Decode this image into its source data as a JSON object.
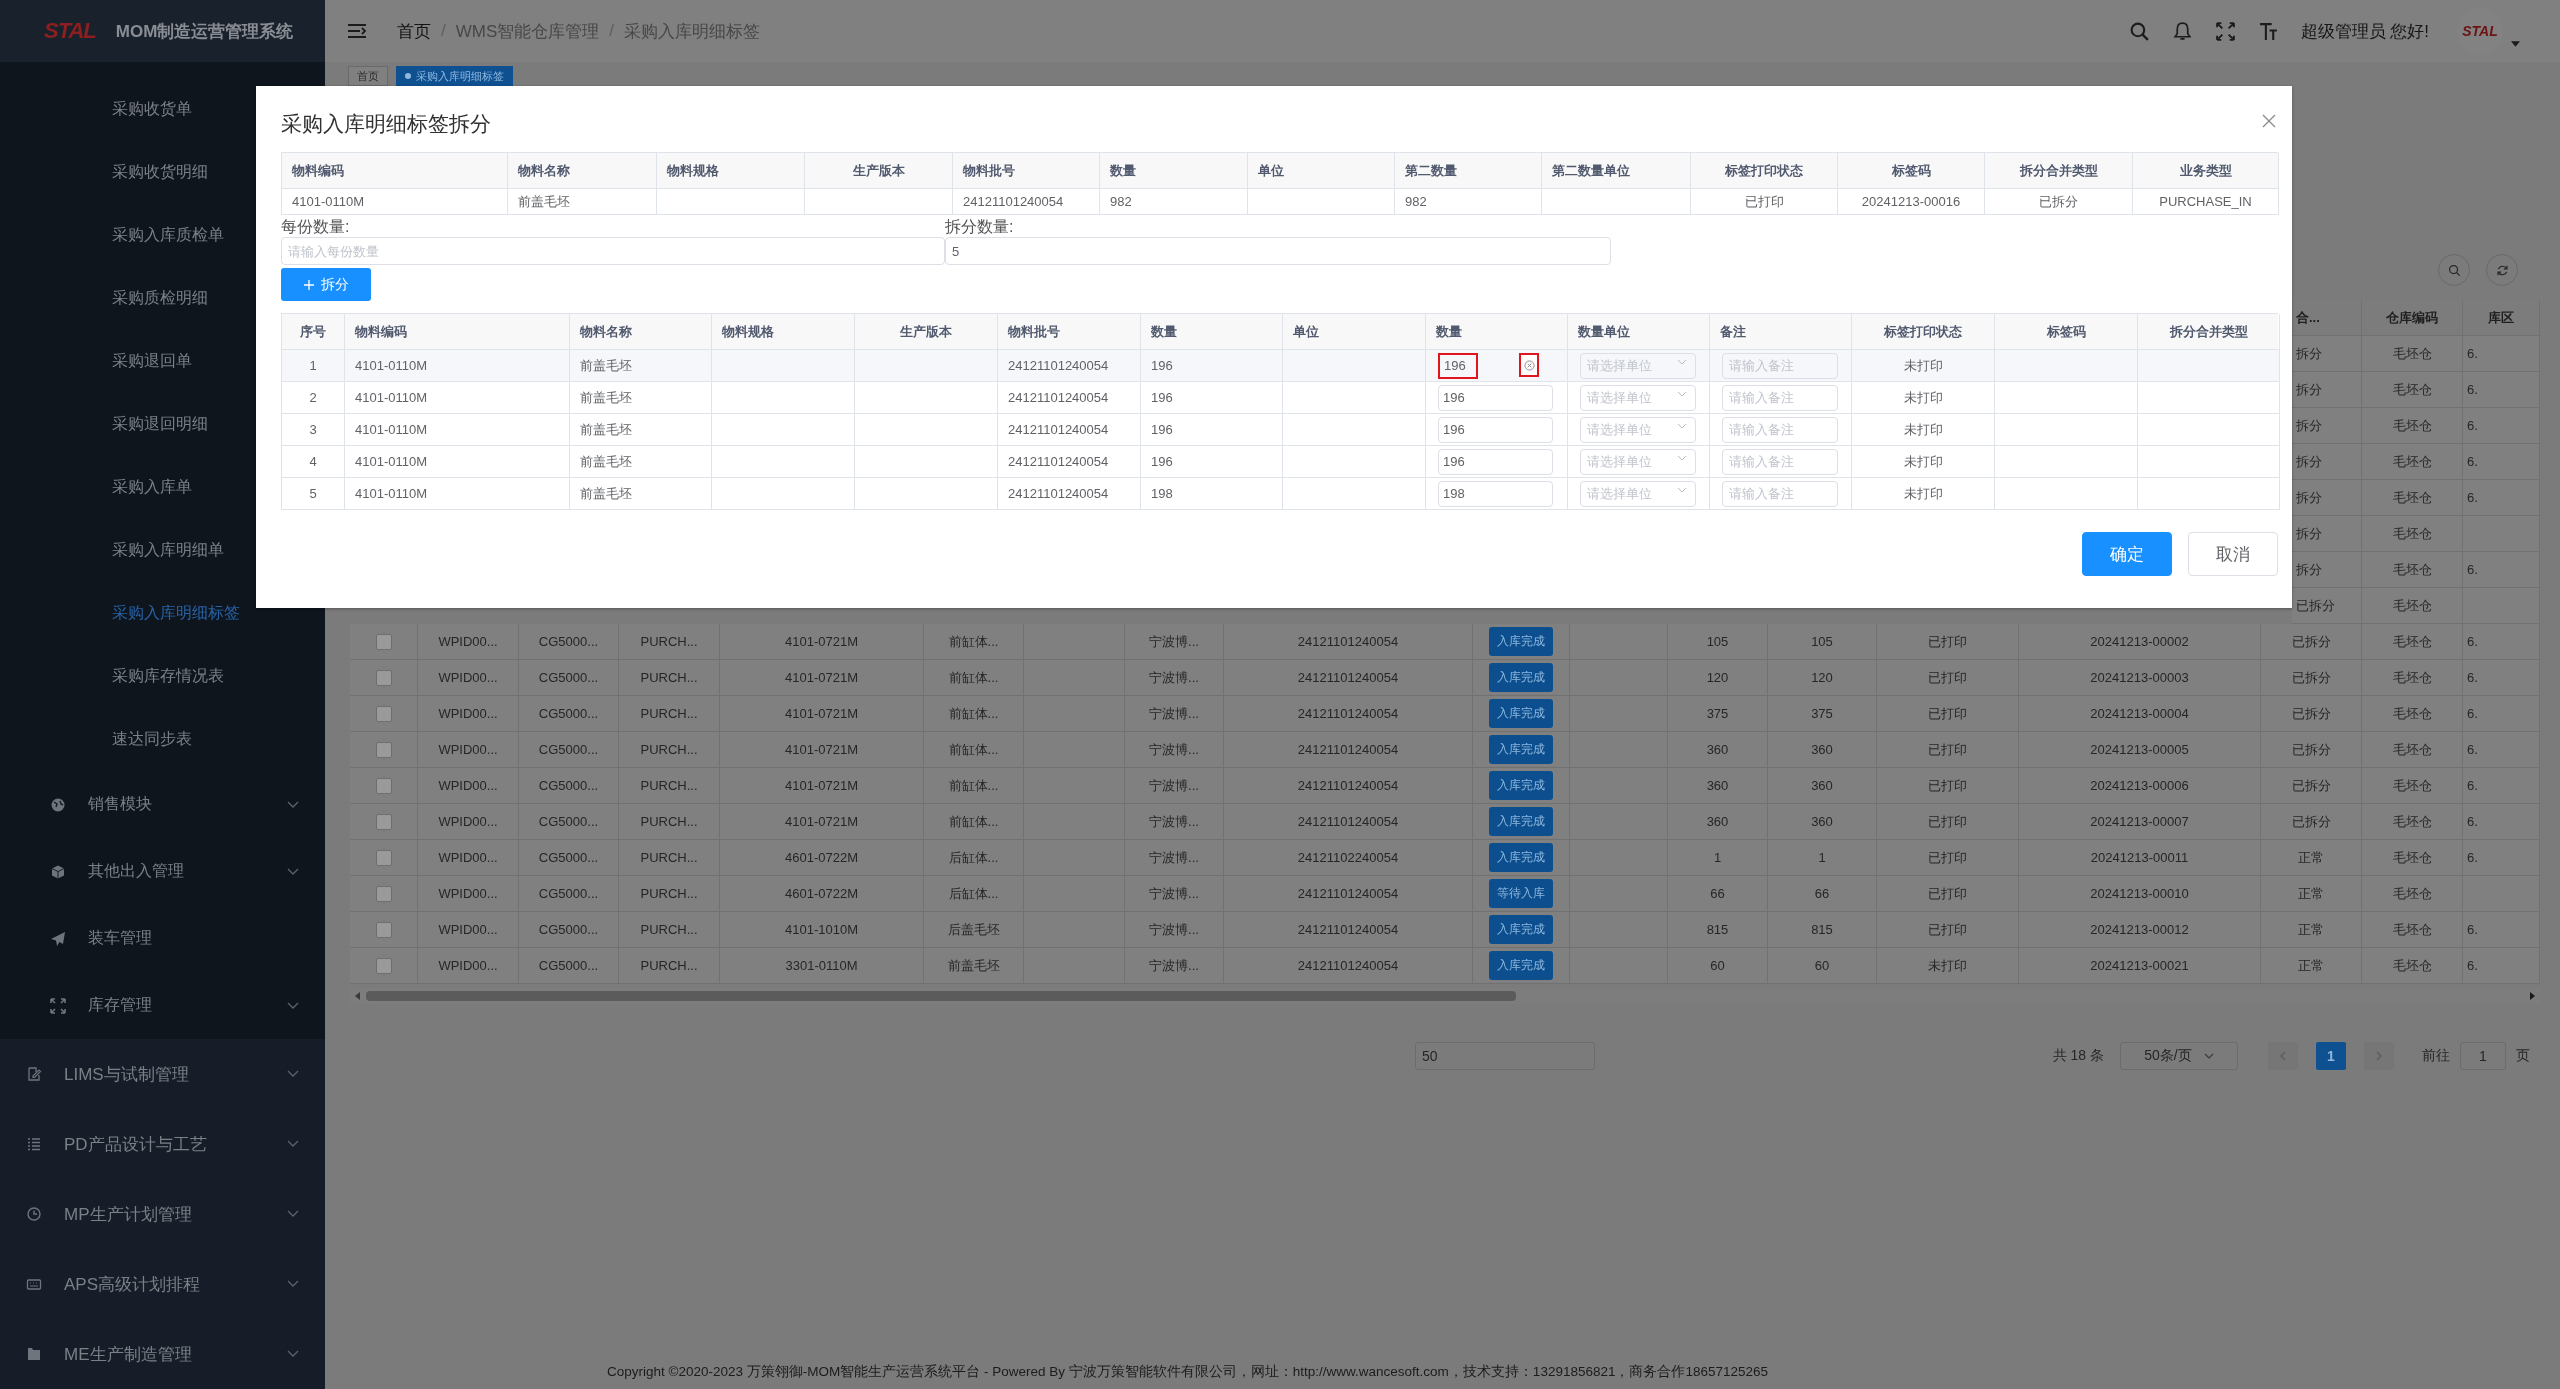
{
  "sidebar": {
    "logo": "STAL",
    "title": "MOM制造运营管理系统",
    "sub_items": [
      {
        "label": "采购收货单",
        "selected": false
      },
      {
        "label": "采购收货明细",
        "selected": false
      },
      {
        "label": "采购入库质检单",
        "selected": false
      },
      {
        "label": "采购质检明细",
        "selected": false
      },
      {
        "label": "采购退回单",
        "selected": false
      },
      {
        "label": "采购退回明细",
        "selected": false
      },
      {
        "label": "采购入库单",
        "selected": false
      },
      {
        "label": "采购入库明细单",
        "selected": false
      },
      {
        "label": "采购入库明细标签",
        "selected": true
      },
      {
        "label": "采购库存情况表",
        "selected": false
      },
      {
        "label": "速达同步表",
        "selected": false
      }
    ],
    "modules": [
      {
        "label": "销售模块",
        "kind": "group"
      },
      {
        "label": "其他出入管理",
        "kind": "group"
      },
      {
        "label": "装车管理",
        "kind": "leaf"
      },
      {
        "label": "库存管理",
        "kind": "group"
      }
    ],
    "menus": [
      {
        "label": "LIMS与试制管理"
      },
      {
        "label": "PD产品设计与工艺"
      },
      {
        "label": "MP生产计划管理"
      },
      {
        "label": "APS高级计划排程"
      },
      {
        "label": "ME生产制造管理"
      }
    ]
  },
  "header": {
    "breadcrumb": [
      "首页",
      "WMS智能仓库管理",
      "采购入库明细标签"
    ],
    "separator": "/",
    "greeting": "超级管理员 您好!",
    "avatar_logo": "STAL"
  },
  "tags": [
    {
      "label": "首页",
      "selected": false
    },
    {
      "label": "采购入库明细标签",
      "selected": true
    }
  ],
  "data_table": {
    "visible_columns": [
      "合...",
      "仓库编码",
      "库区"
    ],
    "partial_rows": [
      {
        "split": "拆分",
        "warehouse": "毛坯仓",
        "area": "6."
      },
      {
        "split": "拆分",
        "warehouse": "毛坯仓",
        "area": "6."
      },
      {
        "split": "拆分",
        "warehouse": "毛坯仓",
        "area": "6."
      },
      {
        "split": "拆分",
        "warehouse": "毛坯仓",
        "area": "6."
      },
      {
        "split": "拆分",
        "warehouse": "毛坯仓",
        "area": "6."
      },
      {
        "split": "拆分",
        "warehouse": "毛坯仓"
      },
      {
        "split": "拆分",
        "warehouse": "毛坯仓",
        "area": "6."
      },
      {
        "split": "已拆分",
        "warehouse": "毛坯仓"
      }
    ],
    "rows": [
      {
        "checked": false,
        "wpid": "WPID00...",
        "order": "CG5000...",
        "type": "PURCH...",
        "code": "4101-0721M",
        "name": "前缸体...",
        "supplier": "宁波博...",
        "batch": "24121101240054",
        "status": "入库完成",
        "qty": "105",
        "qty2": "105",
        "print": "已打印",
        "label": "20241213-00002",
        "split": "已拆分",
        "warehouse": "毛坯仓",
        "area": "6."
      },
      {
        "checked": false,
        "wpid": "WPID00...",
        "order": "CG5000...",
        "type": "PURCH...",
        "code": "4101-0721M",
        "name": "前缸体...",
        "supplier": "宁波博...",
        "batch": "24121101240054",
        "status": "入库完成",
        "qty": "120",
        "qty2": "120",
        "print": "已打印",
        "label": "20241213-00003",
        "split": "已拆分",
        "warehouse": "毛坯仓",
        "area": "6."
      },
      {
        "checked": false,
        "wpid": "WPID00...",
        "order": "CG5000...",
        "type": "PURCH...",
        "code": "4101-0721M",
        "name": "前缸体...",
        "supplier": "宁波博...",
        "batch": "24121101240054",
        "status": "入库完成",
        "qty": "375",
        "qty2": "375",
        "print": "已打印",
        "label": "20241213-00004",
        "split": "已拆分",
        "warehouse": "毛坯仓",
        "area": "6."
      },
      {
        "checked": false,
        "wpid": "WPID00...",
        "order": "CG5000...",
        "type": "PURCH...",
        "code": "4101-0721M",
        "name": "前缸体...",
        "supplier": "宁波博...",
        "batch": "24121101240054",
        "status": "入库完成",
        "qty": "360",
        "qty2": "360",
        "print": "已打印",
        "label": "20241213-00005",
        "split": "已拆分",
        "warehouse": "毛坯仓",
        "area": "6."
      },
      {
        "checked": false,
        "wpid": "WPID00...",
        "order": "CG5000...",
        "type": "PURCH...",
        "code": "4101-0721M",
        "name": "前缸体...",
        "supplier": "宁波博...",
        "batch": "24121101240054",
        "status": "入库完成",
        "qty": "360",
        "qty2": "360",
        "print": "已打印",
        "label": "20241213-00006",
        "split": "已拆分",
        "warehouse": "毛坯仓",
        "area": "6."
      },
      {
        "checked": false,
        "wpid": "WPID00...",
        "order": "CG5000...",
        "type": "PURCH...",
        "code": "4101-0721M",
        "name": "前缸体...",
        "supplier": "宁波博...",
        "batch": "24121101240054",
        "status": "入库完成",
        "qty": "360",
        "qty2": "360",
        "print": "已打印",
        "label": "20241213-00007",
        "split": "已拆分",
        "warehouse": "毛坯仓",
        "area": "6."
      },
      {
        "checked": false,
        "wpid": "WPID00...",
        "order": "CG5000...",
        "type": "PURCH...",
        "code": "4601-0722M",
        "name": "后缸体...",
        "supplier": "宁波博...",
        "batch": "24121102240054",
        "status": "入库完成",
        "qty": "1",
        "qty2": "1",
        "print": "已打印",
        "label": "20241213-00011",
        "split": "正常",
        "warehouse": "毛坯仓",
        "area": "6."
      },
      {
        "checked": false,
        "wpid": "WPID00...",
        "order": "CG5000...",
        "type": "PURCH...",
        "code": "4601-0722M",
        "name": "后缸体...",
        "supplier": "宁波博...",
        "batch": "24121101240054",
        "status": "等待入库",
        "qty": "66",
        "qty2": "66",
        "print": "已打印",
        "label": "20241213-00010",
        "split": "正常",
        "warehouse": "毛坯仓"
      },
      {
        "checked": false,
        "wpid": "WPID00...",
        "order": "CG5000...",
        "type": "PURCH...",
        "code": "4101-1010M",
        "name": "后盖毛坯",
        "supplier": "宁波博...",
        "batch": "24121101240054",
        "status": "入库完成",
        "qty": "815",
        "qty2": "815",
        "print": "已打印",
        "label": "20241213-00012",
        "split": "正常",
        "warehouse": "毛坯仓",
        "area": "6."
      },
      {
        "checked": false,
        "wpid": "WPID00...",
        "order": "CG5000...",
        "type": "PURCH...",
        "code": "3301-0110M",
        "name": "前盖毛坯",
        "supplier": "宁波博...",
        "batch": "24121101240054",
        "status": "入库完成",
        "qty": "60",
        "qty2": "60",
        "print": "未打印",
        "label": "20241213-00021",
        "split": "正常",
        "warehouse": "毛坯仓",
        "area": "6."
      }
    ]
  },
  "pagination": {
    "size_field": "50",
    "total": "共 18 条",
    "page_size": "50条/页",
    "pages": [
      {
        "label": "1",
        "selected": true
      }
    ],
    "goto_label": "前往",
    "goto_value": "1",
    "goto_suffix": "页"
  },
  "footer": "Copyright ©2020-2023 万策翎御-MOM智能生产运营系统平台 - Powered By 宁波万策智能软件有限公司，网址：http://www.wancesoft.com，技术支持：13291856821，商务合作18657125265",
  "dialog": {
    "title": "采购入库明细标签拆分",
    "source_table": {
      "columns": [
        "物料编码",
        "物料名称",
        "物料规格",
        "生产版本",
        "物料批号",
        "数量",
        "单位",
        "第二数量",
        "第二数量单位",
        "标签打印状态",
        "标签码",
        "拆分合并类型",
        "业务类型"
      ],
      "row": {
        "code": "4101-0110M",
        "name": "前盖毛坯",
        "batch": "24121101240054",
        "qty": "982",
        "second_qty": "982",
        "print_status": "已打印",
        "label_code": "20241213-00016",
        "split_type": "已拆分",
        "biz_type": "PURCHASE_IN"
      }
    },
    "per_qty": {
      "label": "每份数量:",
      "placeholder": "请输入每份数量"
    },
    "split_count": {
      "label": "拆分数量:",
      "value": "5"
    },
    "split_button": "拆分",
    "split_table": {
      "columns": [
        "序号",
        "物料编码",
        "物料名称",
        "物料规格",
        "生产版本",
        "物料批号",
        "数量",
        "单位",
        "数量",
        "数量单位",
        "备注",
        "标签打印状态",
        "标签码",
        "拆分合并类型"
      ],
      "rows": [
        {
          "no": "1",
          "code": "4101-0110M",
          "name": "前盖毛坯",
          "batch": "24121101240054",
          "qty": "196",
          "amount": "196",
          "unit_placeholder": "请选择单位",
          "remark_placeholder": "请输入备注",
          "print_status": "未打印",
          "highlighted": true
        },
        {
          "no": "2",
          "code": "4101-0110M",
          "name": "前盖毛坯",
          "batch": "24121101240054",
          "qty": "196",
          "amount": "196",
          "unit_placeholder": "请选择单位",
          "remark_placeholder": "请输入备注",
          "print_status": "未打印",
          "highlighted": false
        },
        {
          "no": "3",
          "code": "4101-0110M",
          "name": "前盖毛坯",
          "batch": "24121101240054",
          "qty": "196",
          "amount": "196",
          "unit_placeholder": "请选择单位",
          "remark_placeholder": "请输入备注",
          "print_status": "未打印",
          "highlighted": false
        },
        {
          "no": "4",
          "code": "4101-0110M",
          "name": "前盖毛坯",
          "batch": "24121101240054",
          "qty": "196",
          "amount": "196",
          "unit_placeholder": "请选择单位",
          "remark_placeholder": "请输入备注",
          "print_status": "未打印",
          "highlighted": false
        },
        {
          "no": "5",
          "code": "4101-0110M",
          "name": "前盖毛坯",
          "batch": "24121101240054",
          "qty": "198",
          "amount": "198",
          "unit_placeholder": "请选择单位",
          "remark_placeholder": "请输入备注",
          "print_status": "未打印",
          "highlighted": false
        }
      ]
    },
    "buttons": [
      {
        "label": "确定",
        "kind": "primary"
      },
      {
        "label": "取消",
        "kind": "default"
      }
    ]
  }
}
